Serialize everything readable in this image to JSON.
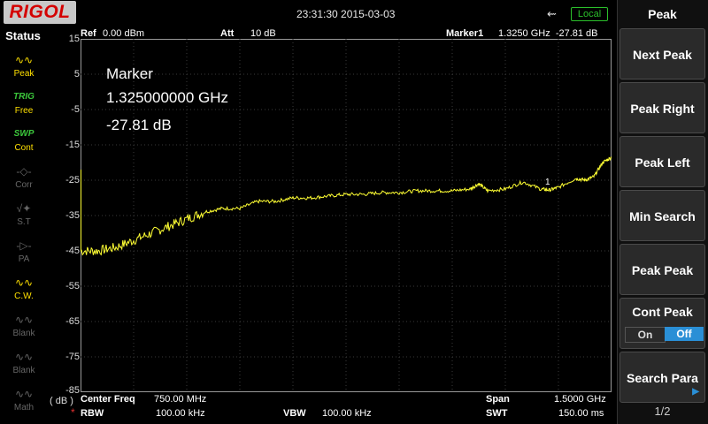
{
  "header": {
    "brand": "RIGOL",
    "datetime": "23:31:30 2015-03-03",
    "usb_icon": "usb-icon",
    "local_badge": "Local"
  },
  "status_panel": {
    "title": "Status",
    "items": [
      {
        "icon": "peak-icon",
        "label": "Peak",
        "state": "on"
      },
      {
        "icon": "trig-icon",
        "label": "Free",
        "tag": "TRIG",
        "state": "on"
      },
      {
        "icon": "swp-icon",
        "label": "Cont",
        "tag": "SWP",
        "state": "on"
      },
      {
        "icon": "corr-icon",
        "label": "Corr",
        "state": "off"
      },
      {
        "icon": "st-icon",
        "label": "S.T",
        "state": "off"
      },
      {
        "icon": "pa-icon",
        "label": "PA",
        "state": "off"
      },
      {
        "icon": "cw-icon",
        "label": "C.W.",
        "state": "on"
      },
      {
        "icon": "blank-icon",
        "label": "Blank",
        "state": "off"
      },
      {
        "icon": "blank-icon",
        "label": "Blank",
        "state": "off"
      },
      {
        "icon": "math-icon",
        "label": "Math",
        "state": "off"
      }
    ]
  },
  "top_info": {
    "ref_label": "Ref",
    "ref_value": "0.00 dBm",
    "att_label": "Att",
    "att_value": "10 dB",
    "marker_label": "Marker1",
    "marker_value": "1.3250 GHz  -27.81 dB"
  },
  "y_axis": {
    "unit": "( dB )",
    "ticks": [
      "15",
      "5",
      "-5",
      "-15",
      "-25",
      "-35",
      "-45",
      "-55",
      "-65",
      "-75",
      "-85"
    ]
  },
  "marker_readout": {
    "title": "Marker",
    "frequency": "1.325000000 GHz",
    "level": "-27.81 dB",
    "label": "1"
  },
  "bottom_info": {
    "center_label": "Center Freq",
    "center_value": "750.00 MHz",
    "span_label": "Span",
    "span_value": "1.5000 GHz",
    "rbw_label": "RBW",
    "rbw_value": "100.00 kHz",
    "vbw_label": "VBW",
    "vbw_value": "100.00 kHz",
    "swt_label": "SWT",
    "swt_value": "150.00 ms"
  },
  "softkeys": {
    "title": "Peak",
    "next_peak": "Next Peak",
    "peak_right": "Peak Right",
    "peak_left": "Peak Left",
    "min_search": "Min Search",
    "peak_peak": "Peak Peak",
    "cont_peak": "Cont Peak",
    "cont_on": "On",
    "cont_off": "Off",
    "search_para": "Search Para",
    "page": "1/2"
  },
  "colors": {
    "trace": "#ffff33",
    "brand_red": "#d40000",
    "accent_blue": "#2a8fd6",
    "local_green": "#2bbf2b"
  },
  "chart_data": {
    "type": "line",
    "x_range_ghz": [
      0,
      1.5
    ],
    "ylim": [
      -85,
      15
    ],
    "x": [
      0.0,
      0.05,
      0.1,
      0.15,
      0.2,
      0.25,
      0.3,
      0.35,
      0.4,
      0.45,
      0.5,
      0.55,
      0.6,
      0.65,
      0.7,
      0.75,
      0.8,
      0.85,
      0.9,
      0.95,
      1.0,
      1.05,
      1.1,
      1.125,
      1.15,
      1.2,
      1.25,
      1.3,
      1.325,
      1.35,
      1.4,
      1.425,
      1.45,
      1.475,
      1.5
    ],
    "values": [
      -45,
      -45,
      -44,
      -42,
      -40,
      -38,
      -36,
      -34,
      -33,
      -33,
      -31,
      -31,
      -30,
      -30,
      -29.5,
      -29,
      -29,
      -28.5,
      -28.5,
      -28,
      -28,
      -28,
      -27.5,
      -26,
      -28,
      -27.5,
      -25.5,
      -27.5,
      -27.81,
      -27,
      -24.5,
      -25,
      -24,
      -20,
      -18.5
    ],
    "marker": {
      "x": 1.325,
      "y": -27.81
    }
  }
}
